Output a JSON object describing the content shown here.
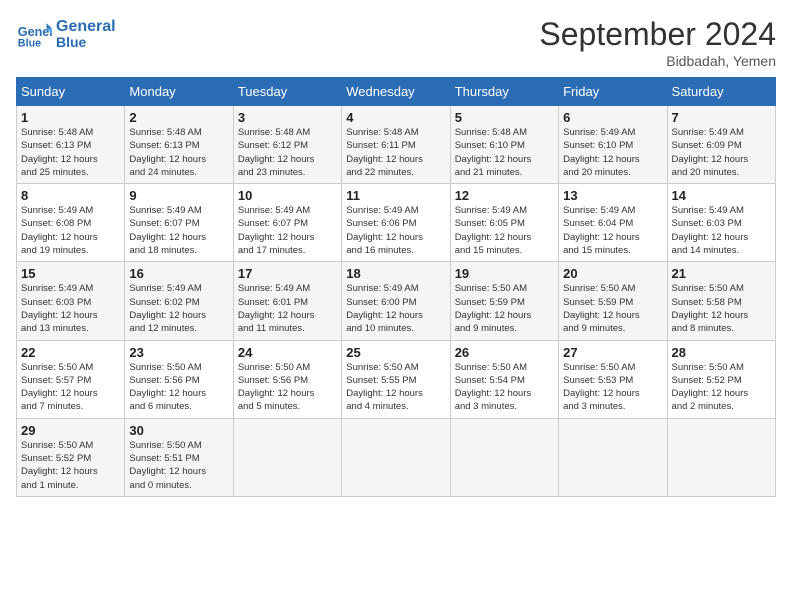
{
  "header": {
    "logo_line1": "General",
    "logo_line2": "Blue",
    "month": "September 2024",
    "location": "Bidbadah, Yemen"
  },
  "weekdays": [
    "Sunday",
    "Monday",
    "Tuesday",
    "Wednesday",
    "Thursday",
    "Friday",
    "Saturday"
  ],
  "weeks": [
    [
      {
        "day": "1",
        "info": "Sunrise: 5:48 AM\nSunset: 6:13 PM\nDaylight: 12 hours\nand 25 minutes."
      },
      {
        "day": "2",
        "info": "Sunrise: 5:48 AM\nSunset: 6:13 PM\nDaylight: 12 hours\nand 24 minutes."
      },
      {
        "day": "3",
        "info": "Sunrise: 5:48 AM\nSunset: 6:12 PM\nDaylight: 12 hours\nand 23 minutes."
      },
      {
        "day": "4",
        "info": "Sunrise: 5:48 AM\nSunset: 6:11 PM\nDaylight: 12 hours\nand 22 minutes."
      },
      {
        "day": "5",
        "info": "Sunrise: 5:48 AM\nSunset: 6:10 PM\nDaylight: 12 hours\nand 21 minutes."
      },
      {
        "day": "6",
        "info": "Sunrise: 5:49 AM\nSunset: 6:10 PM\nDaylight: 12 hours\nand 20 minutes."
      },
      {
        "day": "7",
        "info": "Sunrise: 5:49 AM\nSunset: 6:09 PM\nDaylight: 12 hours\nand 20 minutes."
      }
    ],
    [
      {
        "day": "8",
        "info": "Sunrise: 5:49 AM\nSunset: 6:08 PM\nDaylight: 12 hours\nand 19 minutes."
      },
      {
        "day": "9",
        "info": "Sunrise: 5:49 AM\nSunset: 6:07 PM\nDaylight: 12 hours\nand 18 minutes."
      },
      {
        "day": "10",
        "info": "Sunrise: 5:49 AM\nSunset: 6:07 PM\nDaylight: 12 hours\nand 17 minutes."
      },
      {
        "day": "11",
        "info": "Sunrise: 5:49 AM\nSunset: 6:06 PM\nDaylight: 12 hours\nand 16 minutes."
      },
      {
        "day": "12",
        "info": "Sunrise: 5:49 AM\nSunset: 6:05 PM\nDaylight: 12 hours\nand 15 minutes."
      },
      {
        "day": "13",
        "info": "Sunrise: 5:49 AM\nSunset: 6:04 PM\nDaylight: 12 hours\nand 15 minutes."
      },
      {
        "day": "14",
        "info": "Sunrise: 5:49 AM\nSunset: 6:03 PM\nDaylight: 12 hours\nand 14 minutes."
      }
    ],
    [
      {
        "day": "15",
        "info": "Sunrise: 5:49 AM\nSunset: 6:03 PM\nDaylight: 12 hours\nand 13 minutes."
      },
      {
        "day": "16",
        "info": "Sunrise: 5:49 AM\nSunset: 6:02 PM\nDaylight: 12 hours\nand 12 minutes."
      },
      {
        "day": "17",
        "info": "Sunrise: 5:49 AM\nSunset: 6:01 PM\nDaylight: 12 hours\nand 11 minutes."
      },
      {
        "day": "18",
        "info": "Sunrise: 5:49 AM\nSunset: 6:00 PM\nDaylight: 12 hours\nand 10 minutes."
      },
      {
        "day": "19",
        "info": "Sunrise: 5:50 AM\nSunset: 5:59 PM\nDaylight: 12 hours\nand 9 minutes."
      },
      {
        "day": "20",
        "info": "Sunrise: 5:50 AM\nSunset: 5:59 PM\nDaylight: 12 hours\nand 9 minutes."
      },
      {
        "day": "21",
        "info": "Sunrise: 5:50 AM\nSunset: 5:58 PM\nDaylight: 12 hours\nand 8 minutes."
      }
    ],
    [
      {
        "day": "22",
        "info": "Sunrise: 5:50 AM\nSunset: 5:57 PM\nDaylight: 12 hours\nand 7 minutes."
      },
      {
        "day": "23",
        "info": "Sunrise: 5:50 AM\nSunset: 5:56 PM\nDaylight: 12 hours\nand 6 minutes."
      },
      {
        "day": "24",
        "info": "Sunrise: 5:50 AM\nSunset: 5:56 PM\nDaylight: 12 hours\nand 5 minutes."
      },
      {
        "day": "25",
        "info": "Sunrise: 5:50 AM\nSunset: 5:55 PM\nDaylight: 12 hours\nand 4 minutes."
      },
      {
        "day": "26",
        "info": "Sunrise: 5:50 AM\nSunset: 5:54 PM\nDaylight: 12 hours\nand 3 minutes."
      },
      {
        "day": "27",
        "info": "Sunrise: 5:50 AM\nSunset: 5:53 PM\nDaylight: 12 hours\nand 3 minutes."
      },
      {
        "day": "28",
        "info": "Sunrise: 5:50 AM\nSunset: 5:52 PM\nDaylight: 12 hours\nand 2 minutes."
      }
    ],
    [
      {
        "day": "29",
        "info": "Sunrise: 5:50 AM\nSunset: 5:52 PM\nDaylight: 12 hours\nand 1 minute."
      },
      {
        "day": "30",
        "info": "Sunrise: 5:50 AM\nSunset: 5:51 PM\nDaylight: 12 hours\nand 0 minutes."
      },
      null,
      null,
      null,
      null,
      null
    ]
  ]
}
